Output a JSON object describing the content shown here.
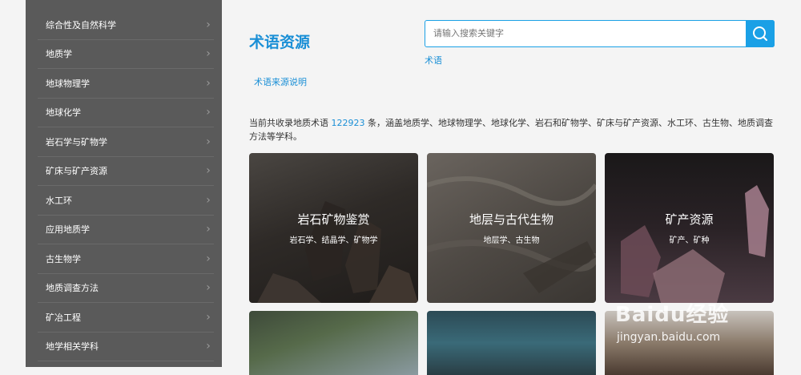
{
  "sidebar": {
    "items": [
      {
        "label": "综合性及自然科学"
      },
      {
        "label": "地质学"
      },
      {
        "label": "地球物理学"
      },
      {
        "label": "地球化学"
      },
      {
        "label": "岩石学与矿物学"
      },
      {
        "label": "矿床与矿产资源"
      },
      {
        "label": "水工环"
      },
      {
        "label": "应用地质学"
      },
      {
        "label": "古生物学"
      },
      {
        "label": "地质调查方法"
      },
      {
        "label": "矿冶工程"
      },
      {
        "label": "地学相关学科"
      }
    ]
  },
  "header": {
    "title": "术语资源",
    "source_link": "术语来源说明"
  },
  "search": {
    "placeholder": "请输入搜索关键字",
    "value": "",
    "tag": "术语"
  },
  "intro": {
    "prefix": "当前共收录地质术语",
    "count": "122923",
    "suffix": "条，涵盖地质学、地球物理学、地球化学、岩石和矿物学、矿床与矿产资源、水工环、古生物、地质调查方法等学科。"
  },
  "cards": [
    {
      "title": "岩石矿物鉴赏",
      "subtitle": "岩石学、结晶学、矿物学"
    },
    {
      "title": "地层与古代生物",
      "subtitle": "地层学、古生物"
    },
    {
      "title": "矿产资源",
      "subtitle": "矿产、矿种"
    }
  ],
  "watermark": {
    "brand": "Baidu经验",
    "url": "jingyan.baidu.com"
  },
  "colors": {
    "accent": "#1a8fd6",
    "search_button": "#1aa0e6",
    "sidebar_bg": "#5a5a5a"
  }
}
